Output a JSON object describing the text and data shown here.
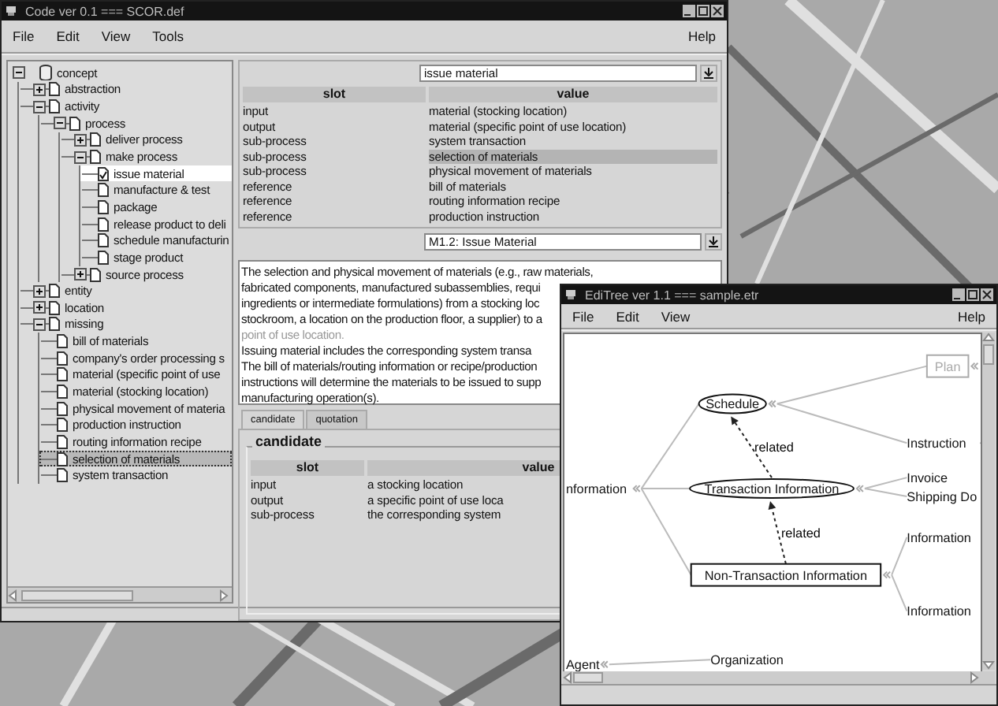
{
  "main_window": {
    "title": "Code ver 0.1 === SCOR.def",
    "menu": [
      "File",
      "Edit",
      "View",
      "Tools"
    ],
    "help": "Help",
    "tree": {
      "label": "concept",
      "expanded": true,
      "selected": false,
      "focused": false,
      "children": [
        {
          "label": "abstraction",
          "expanded": false,
          "selected": false,
          "focused": false
        },
        {
          "label": "activity",
          "expanded": true,
          "selected": false,
          "focused": false,
          "children": [
            {
              "label": "process",
              "expanded": true,
              "selected": false,
              "focused": false,
              "children": [
                {
                  "label": "deliver process",
                  "expanded": false,
                  "selected": false,
                  "focused": false
                },
                {
                  "label": "make process",
                  "expanded": true,
                  "selected": false,
                  "focused": false,
                  "children": [
                    {
                      "label": "issue material",
                      "selected": true,
                      "focused": false
                    },
                    {
                      "label": "manufacture & test",
                      "selected": false,
                      "focused": false
                    },
                    {
                      "label": "package",
                      "selected": false,
                      "focused": false
                    },
                    {
                      "label": "release product to deli",
                      "selected": false,
                      "focused": false
                    },
                    {
                      "label": "schedule manufacturin",
                      "selected": false,
                      "focused": false
                    },
                    {
                      "label": "stage product",
                      "selected": false,
                      "focused": false
                    }
                  ]
                },
                {
                  "label": "source process",
                  "expanded": false,
                  "selected": false,
                  "focused": false
                }
              ]
            }
          ]
        },
        {
          "label": "entity",
          "expanded": false,
          "selected": false,
          "focused": false
        },
        {
          "label": "location",
          "expanded": false,
          "selected": false,
          "focused": false
        },
        {
          "label": "missing",
          "expanded": true,
          "selected": false,
          "focused": false,
          "children": [
            {
              "label": "bill of materials",
              "selected": false,
              "focused": false
            },
            {
              "label": "company's order processing s",
              "selected": false,
              "focused": false
            },
            {
              "label": "material (specific point of use",
              "selected": false,
              "focused": false
            },
            {
              "label": "material (stocking location)",
              "selected": false,
              "focused": false
            },
            {
              "label": "physical movement of materia",
              "selected": false,
              "focused": false
            },
            {
              "label": "production instruction",
              "selected": false,
              "focused": false
            },
            {
              "label": "routing information recipe",
              "selected": false,
              "focused": false
            },
            {
              "label": "selection of materials",
              "selected": false,
              "focused": true
            },
            {
              "label": "system transaction",
              "selected": false,
              "focused": false
            }
          ]
        }
      ]
    },
    "slots": {
      "combo": "issue material",
      "columns": [
        "slot",
        "value"
      ],
      "rows": [
        {
          "slot": "input",
          "value": "material (stocking location)",
          "selected": false
        },
        {
          "slot": "output",
          "value": "material (specific point of use location)",
          "selected": false
        },
        {
          "slot": "sub-process",
          "value": "system transaction",
          "selected": false
        },
        {
          "slot": "sub-process",
          "value": "selection of materials",
          "selected": true
        },
        {
          "slot": "sub-process",
          "value": "physical movement of materials",
          "selected": false
        },
        {
          "slot": "reference",
          "value": "bill of materials",
          "selected": false
        },
        {
          "slot": "reference",
          "value": "routing information recipe",
          "selected": false
        },
        {
          "slot": "reference",
          "value": "production instruction",
          "selected": false
        }
      ]
    },
    "definition": {
      "combo": "M1.2: Issue Material",
      "lines": [
        {
          "text": "The selection and physical movement of materials (e.g., raw materials,",
          "dimmed": false
        },
        {
          "text": "fabricated components, manufactured subassemblies, requi",
          "dimmed": false
        },
        {
          "text": "ingredients or intermediate formulations) from a stocking loc",
          "dimmed": false
        },
        {
          "text": "stockroom, a location on the production floor, a supplier) to a",
          "dimmed": false
        },
        {
          "text": "point of use location.",
          "dimmed": true
        },
        {
          "text": "Issuing material includes the corresponding system transa",
          "dimmed": false
        },
        {
          "text": "The bill of materials/routing information or recipe/production",
          "dimmed": false
        },
        {
          "text": "instructions will determine the materials to be issued to supp",
          "dimmed": false
        },
        {
          "text": "manufacturing operation(s).",
          "dimmed": false
        }
      ]
    },
    "tabs": [
      {
        "label": "candidate",
        "selected": true
      },
      {
        "label": "quotation",
        "selected": false
      }
    ],
    "candidate": {
      "title": "candidate",
      "columns": [
        "slot",
        "value"
      ],
      "rows": [
        {
          "slot": "input",
          "value": "a stocking location"
        },
        {
          "slot": "output",
          "value": "a specific point of use loca"
        },
        {
          "slot": "sub-process",
          "value": "the corresponding system"
        }
      ]
    }
  },
  "tree_window": {
    "title": "EdiTree ver 1.1 === sample.etr",
    "menu": [
      "File",
      "Edit",
      "View"
    ],
    "help": "Help",
    "graph": {
      "nodes": [
        {
          "label": "Plan",
          "kind": "box",
          "disabled": true,
          "handle": true
        },
        {
          "label": "Schedule",
          "kind": "ellipse",
          "disabled": false,
          "handle": true
        },
        {
          "label": "Instruction",
          "kind": "text",
          "disabled": false,
          "handle": true
        },
        {
          "label": "nformation",
          "kind": "text",
          "disabled": false,
          "handle": true
        },
        {
          "label": "Transaction Information",
          "kind": "ellipse",
          "disabled": false,
          "handle": true
        },
        {
          "label": "Invoice",
          "kind": "text",
          "disabled": false,
          "handle": false
        },
        {
          "label": "Shipping Do",
          "kind": "text",
          "disabled": false,
          "handle": false
        },
        {
          "label": "Non-Transaction Information",
          "kind": "box",
          "disabled": false,
          "handle": true
        },
        {
          "label": "Information",
          "kind": "text",
          "disabled": false,
          "handle": false
        },
        {
          "label": "Information",
          "kind": "text",
          "disabled": false,
          "handle": false
        },
        {
          "label": "Agent",
          "kind": "text",
          "disabled": false,
          "handle": true
        },
        {
          "label": "Organization",
          "kind": "text",
          "disabled": false,
          "handle": false
        }
      ],
      "relation_labels": [
        "related",
        "related"
      ]
    }
  }
}
